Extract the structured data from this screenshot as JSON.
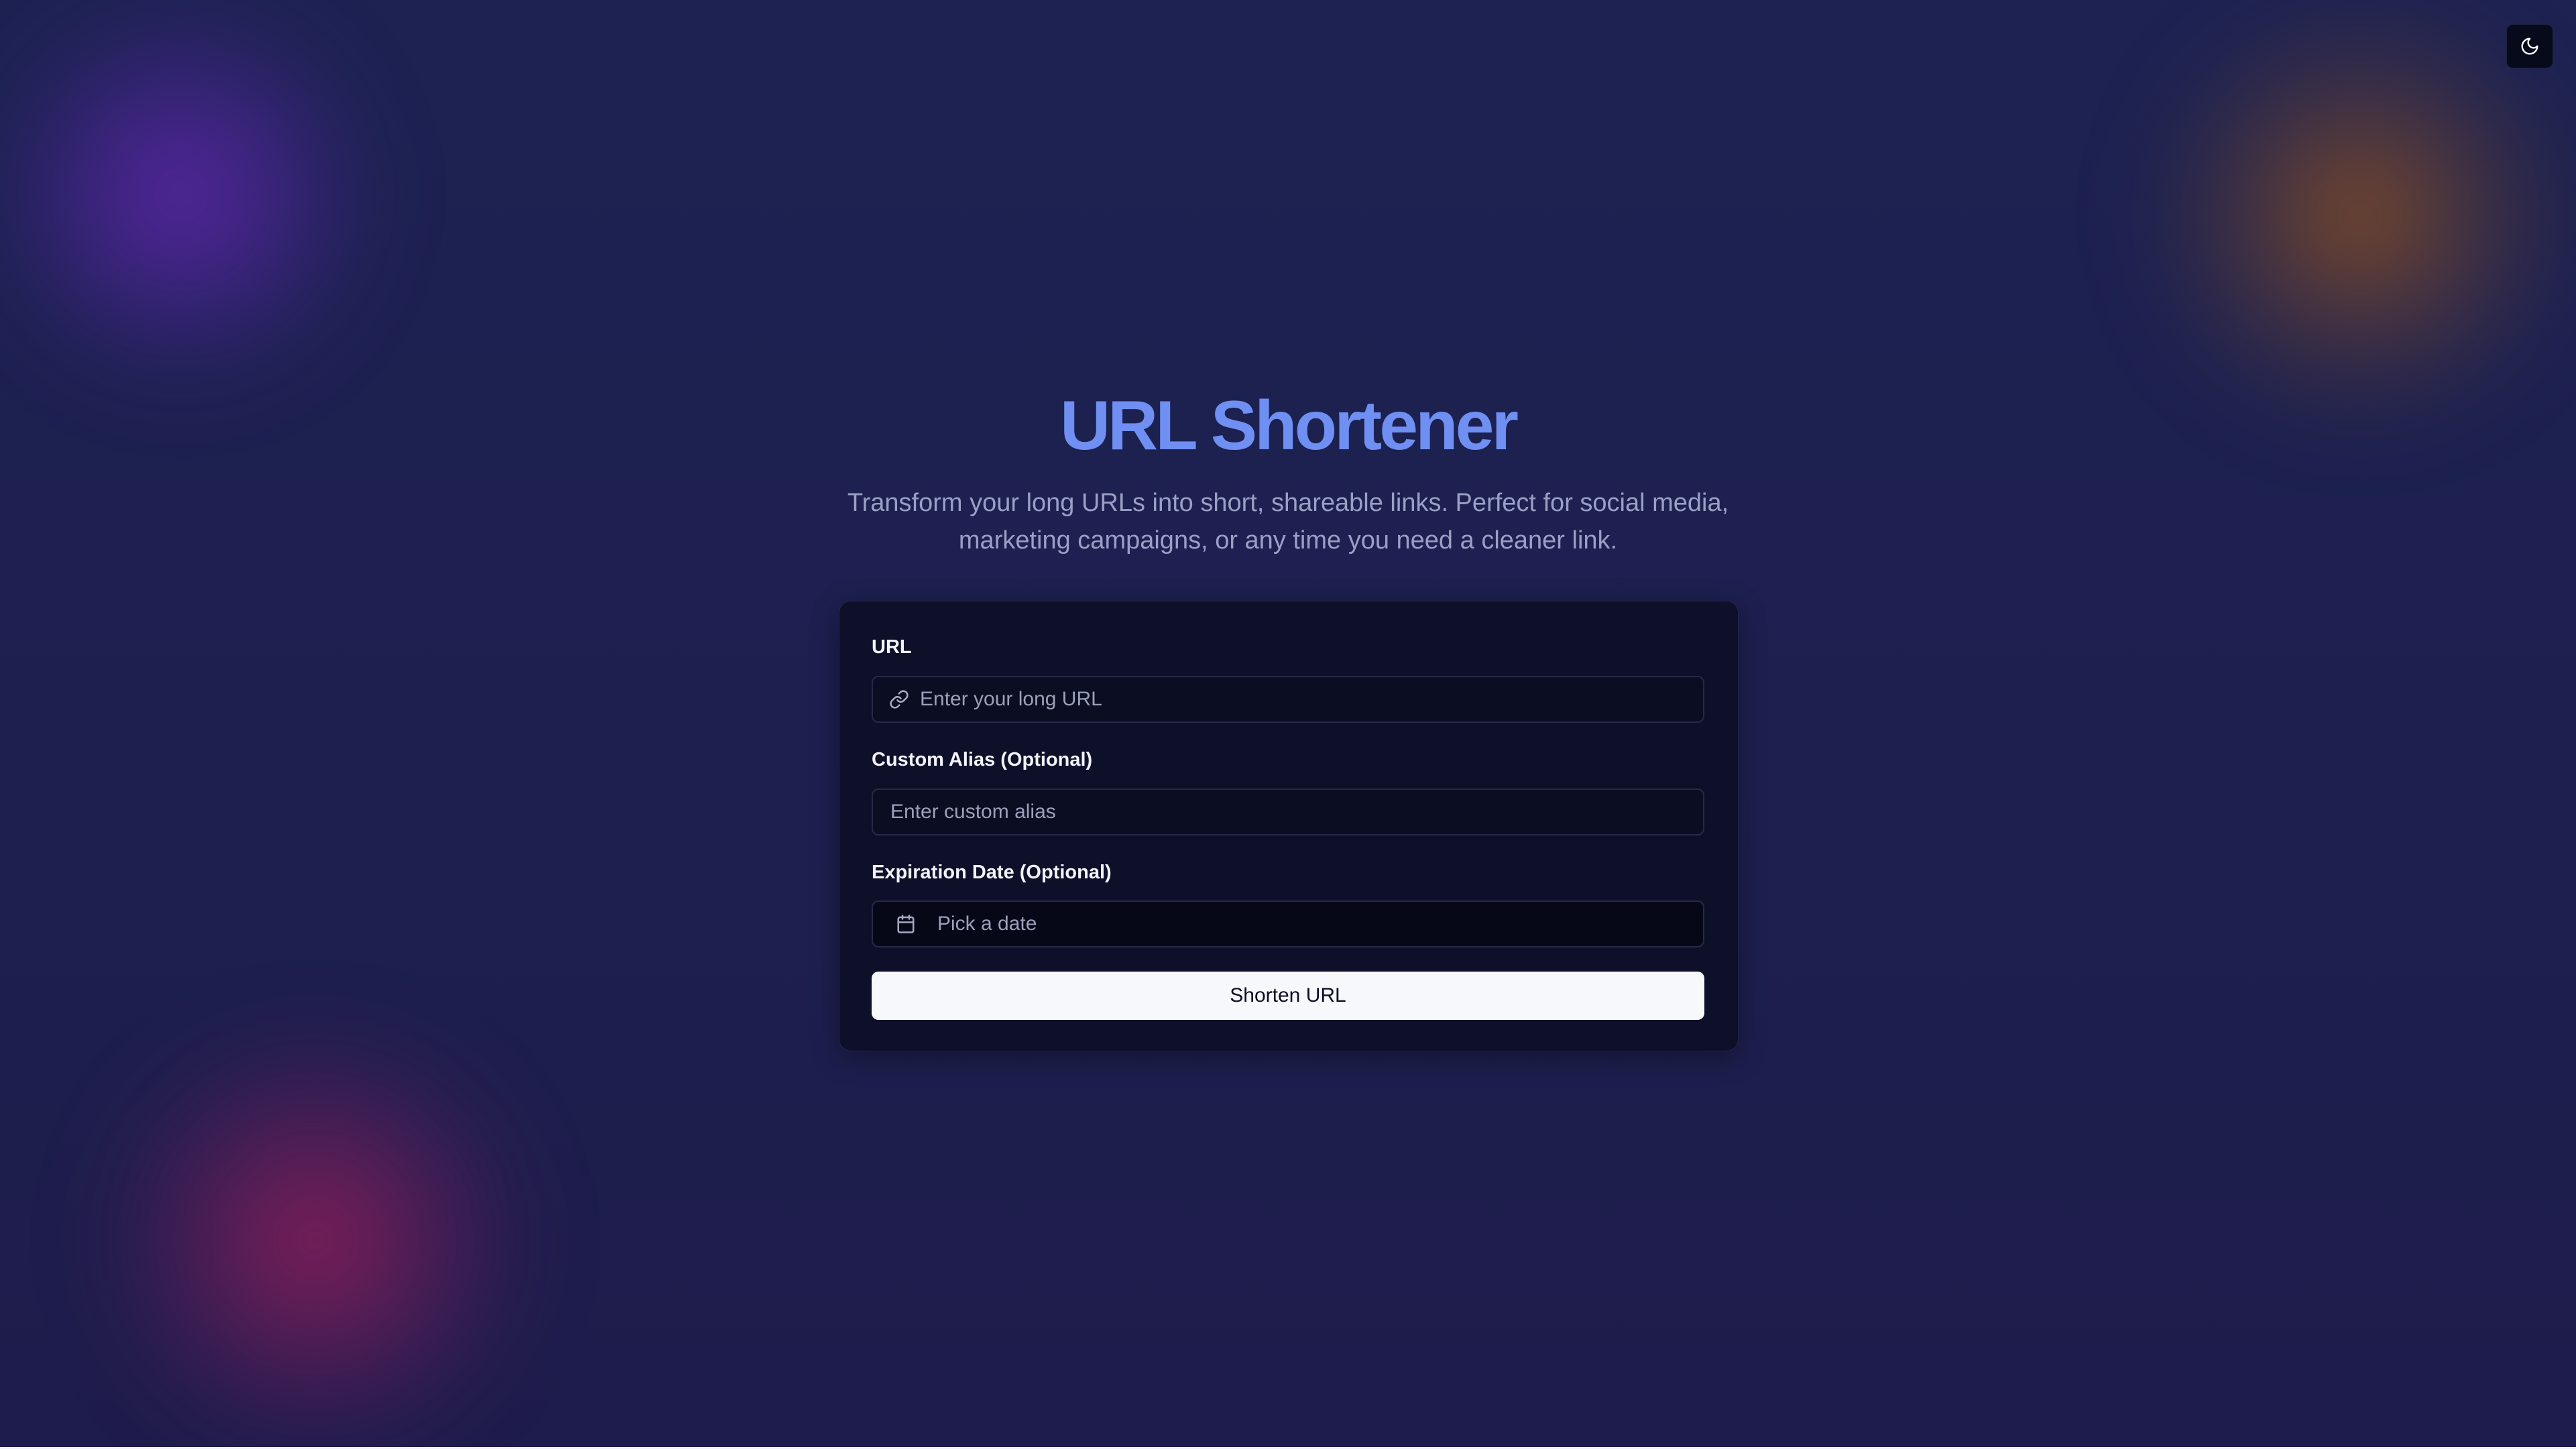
{
  "header": {
    "theme_toggle_icon": "moon-icon"
  },
  "hero": {
    "title": "URL Shortener",
    "subtitle": "Transform your long URLs into short, shareable links. Perfect for social media, marketing campaigns, or any time you need a cleaner link."
  },
  "form": {
    "url": {
      "label": "URL",
      "placeholder": "Enter your long URL",
      "icon": "link-icon"
    },
    "alias": {
      "label": "Custom Alias (Optional)",
      "placeholder": "Enter custom alias"
    },
    "expiration": {
      "label": "Expiration Date (Optional)",
      "placeholder": "Pick a date",
      "icon": "calendar-icon"
    },
    "submit_label": "Shorten URL"
  },
  "colors": {
    "background": "#1d2050",
    "title_accent": "#6f8ff2",
    "card": "#0e1029",
    "button": "#f7f8fc"
  }
}
